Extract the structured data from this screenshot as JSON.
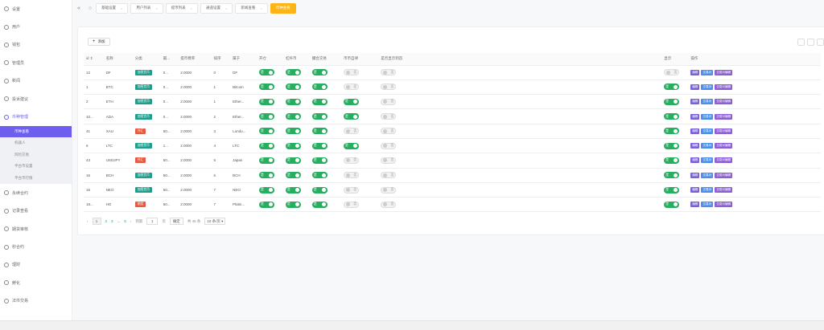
{
  "sidebar": {
    "items": [
      {
        "label": "设置",
        "icon": "settings-icon"
      },
      {
        "label": "用户",
        "icon": "user-icon"
      },
      {
        "label": "钱包",
        "icon": "wallet-icon"
      },
      {
        "label": "管理员",
        "icon": "admin-icon"
      },
      {
        "label": "新闻",
        "icon": "news-icon"
      },
      {
        "label": "投诉建议",
        "icon": "feedback-icon"
      },
      {
        "label": "币种管理",
        "icon": "coin-icon"
      }
    ],
    "subitems": [
      {
        "label": "币种查看",
        "active": true
      },
      {
        "label": "机器人",
        "active": false
      },
      {
        "label": "风险交易",
        "active": false
      },
      {
        "label": "平台币设置",
        "active": false
      },
      {
        "label": "平台币行情",
        "active": false
      }
    ],
    "items_after": [
      {
        "label": "永续合约",
        "icon": "contract-icon"
      },
      {
        "label": "记录查看",
        "icon": "record-icon"
      },
      {
        "label": "期货审核",
        "icon": "audit-icon"
      },
      {
        "label": "秒合约",
        "icon": "seconds-icon"
      },
      {
        "label": "理财",
        "icon": "finance-icon"
      },
      {
        "label": "孵化",
        "icon": "incubate-icon"
      },
      {
        "label": "法币交易",
        "icon": "fiat-icon"
      }
    ]
  },
  "topbar": {
    "tabs": [
      {
        "label": "基础设置",
        "active": false
      },
      {
        "label": "用户列表",
        "active": false
      },
      {
        "label": "提币列表",
        "active": false
      },
      {
        "label": "通道设置",
        "active": false
      },
      {
        "label": "新闻查看",
        "active": false
      },
      {
        "label": "币种查看",
        "active": true
      }
    ]
  },
  "toolbar": {
    "add_label": "添加"
  },
  "table": {
    "headers": [
      "id ⇕",
      "名称",
      "分类",
      "最...",
      "提币费率",
      "排序",
      "属于",
      "开仓",
      "杠杆币",
      "撮合交易",
      "币币自律",
      "是否显示到首",
      "",
      "显示",
      "操作"
    ],
    "rows": [
      {
        "id": "12",
        "name": "DF",
        "cat": "加密货币",
        "cat_type": "teal",
        "min": "0...",
        "fee": "2.0000",
        "sort": "0",
        "belong": "DF",
        "t1": "是",
        "t2": "是",
        "t3": "是",
        "t4": "否",
        "t5": "否",
        "show": "否"
      },
      {
        "id": "1",
        "name": "BTC",
        "cat": "加密货币",
        "cat_type": "teal",
        "min": "0...",
        "fee": "2.0000",
        "sort": "1",
        "belong": "Bitcoin",
        "t1": "是",
        "t2": "是",
        "t3": "是",
        "t4": "否",
        "t5": "否",
        "show": "是"
      },
      {
        "id": "2",
        "name": "ETH",
        "cat": "加密货币",
        "cat_type": "teal",
        "min": "0...",
        "fee": "2.0000",
        "sort": "1",
        "belong": "Ether...",
        "t1": "是",
        "t2": "是",
        "t3": "是",
        "t4": "是",
        "t5": "否",
        "show": "是"
      },
      {
        "id": "10...",
        "name": "ADA",
        "cat": "加密货币",
        "cat_type": "teal",
        "min": "0...",
        "fee": "2.0000",
        "sort": "2",
        "belong": "Ether...",
        "t1": "是",
        "t2": "是",
        "t3": "是",
        "t4": "是",
        "t5": "否",
        "show": "是"
      },
      {
        "id": "41",
        "name": "XAU",
        "cat": "外汇",
        "cat_type": "red",
        "min": "50...",
        "fee": "2.0000",
        "sort": "3",
        "belong": "Londo...",
        "t1": "是",
        "t2": "是",
        "t3": "是",
        "t4": "否",
        "t5": "否",
        "show": "是"
      },
      {
        "id": "6",
        "name": "LTC",
        "cat": "加密货币",
        "cat_type": "teal",
        "min": "1...",
        "fee": "2.0000",
        "sort": "4",
        "belong": "LTC",
        "t1": "是",
        "t2": "是",
        "t3": "是",
        "t4": "是",
        "t5": "否",
        "show": "是"
      },
      {
        "id": "43",
        "name": "USDJPY",
        "cat": "外汇",
        "cat_type": "red",
        "min": "50...",
        "fee": "2.0000",
        "sort": "5",
        "belong": "Japan",
        "t1": "是",
        "t2": "是",
        "t3": "是",
        "t4": "否",
        "t5": "否",
        "show": "是"
      },
      {
        "id": "16",
        "name": "BCH",
        "cat": "加密货币",
        "cat_type": "teal",
        "min": "50...",
        "fee": "2.0000",
        "sort": "6",
        "belong": "BCH",
        "t1": "是",
        "t2": "是",
        "t3": "是",
        "t4": "否",
        "t5": "否",
        "show": "是"
      },
      {
        "id": "16",
        "name": "NEO",
        "cat": "加密货币",
        "cat_type": "teal",
        "min": "50...",
        "fee": "2.0000",
        "sort": "7",
        "belong": "NEO",
        "t1": "是",
        "t2": "是",
        "t3": "是",
        "t4": "否",
        "t5": "否",
        "show": "是"
      },
      {
        "id": "18...",
        "name": "HG",
        "cat": "期货",
        "cat_type": "red",
        "min": "50...",
        "fee": "2.0000",
        "sort": "7",
        "belong": "Platin...",
        "t1": "是",
        "t2": "是",
        "t3": "是",
        "t4": "否",
        "t5": "否",
        "show": "是"
      }
    ],
    "ops": [
      "编辑",
      "交易对",
      "交易对编辑"
    ]
  },
  "pager": {
    "prev": "‹",
    "pages": [
      "1",
      "2",
      "3",
      "...",
      "5"
    ],
    "next": "›",
    "goto_label": "到第",
    "page_input": "1",
    "page_unit": "页",
    "go_btn": "确定",
    "total": "共 45 条",
    "size": "10 条/页"
  },
  "colors": {
    "accent": "#6d5ef0",
    "tab_active": "#fdb418",
    "toggle_on": "#27ae60"
  }
}
